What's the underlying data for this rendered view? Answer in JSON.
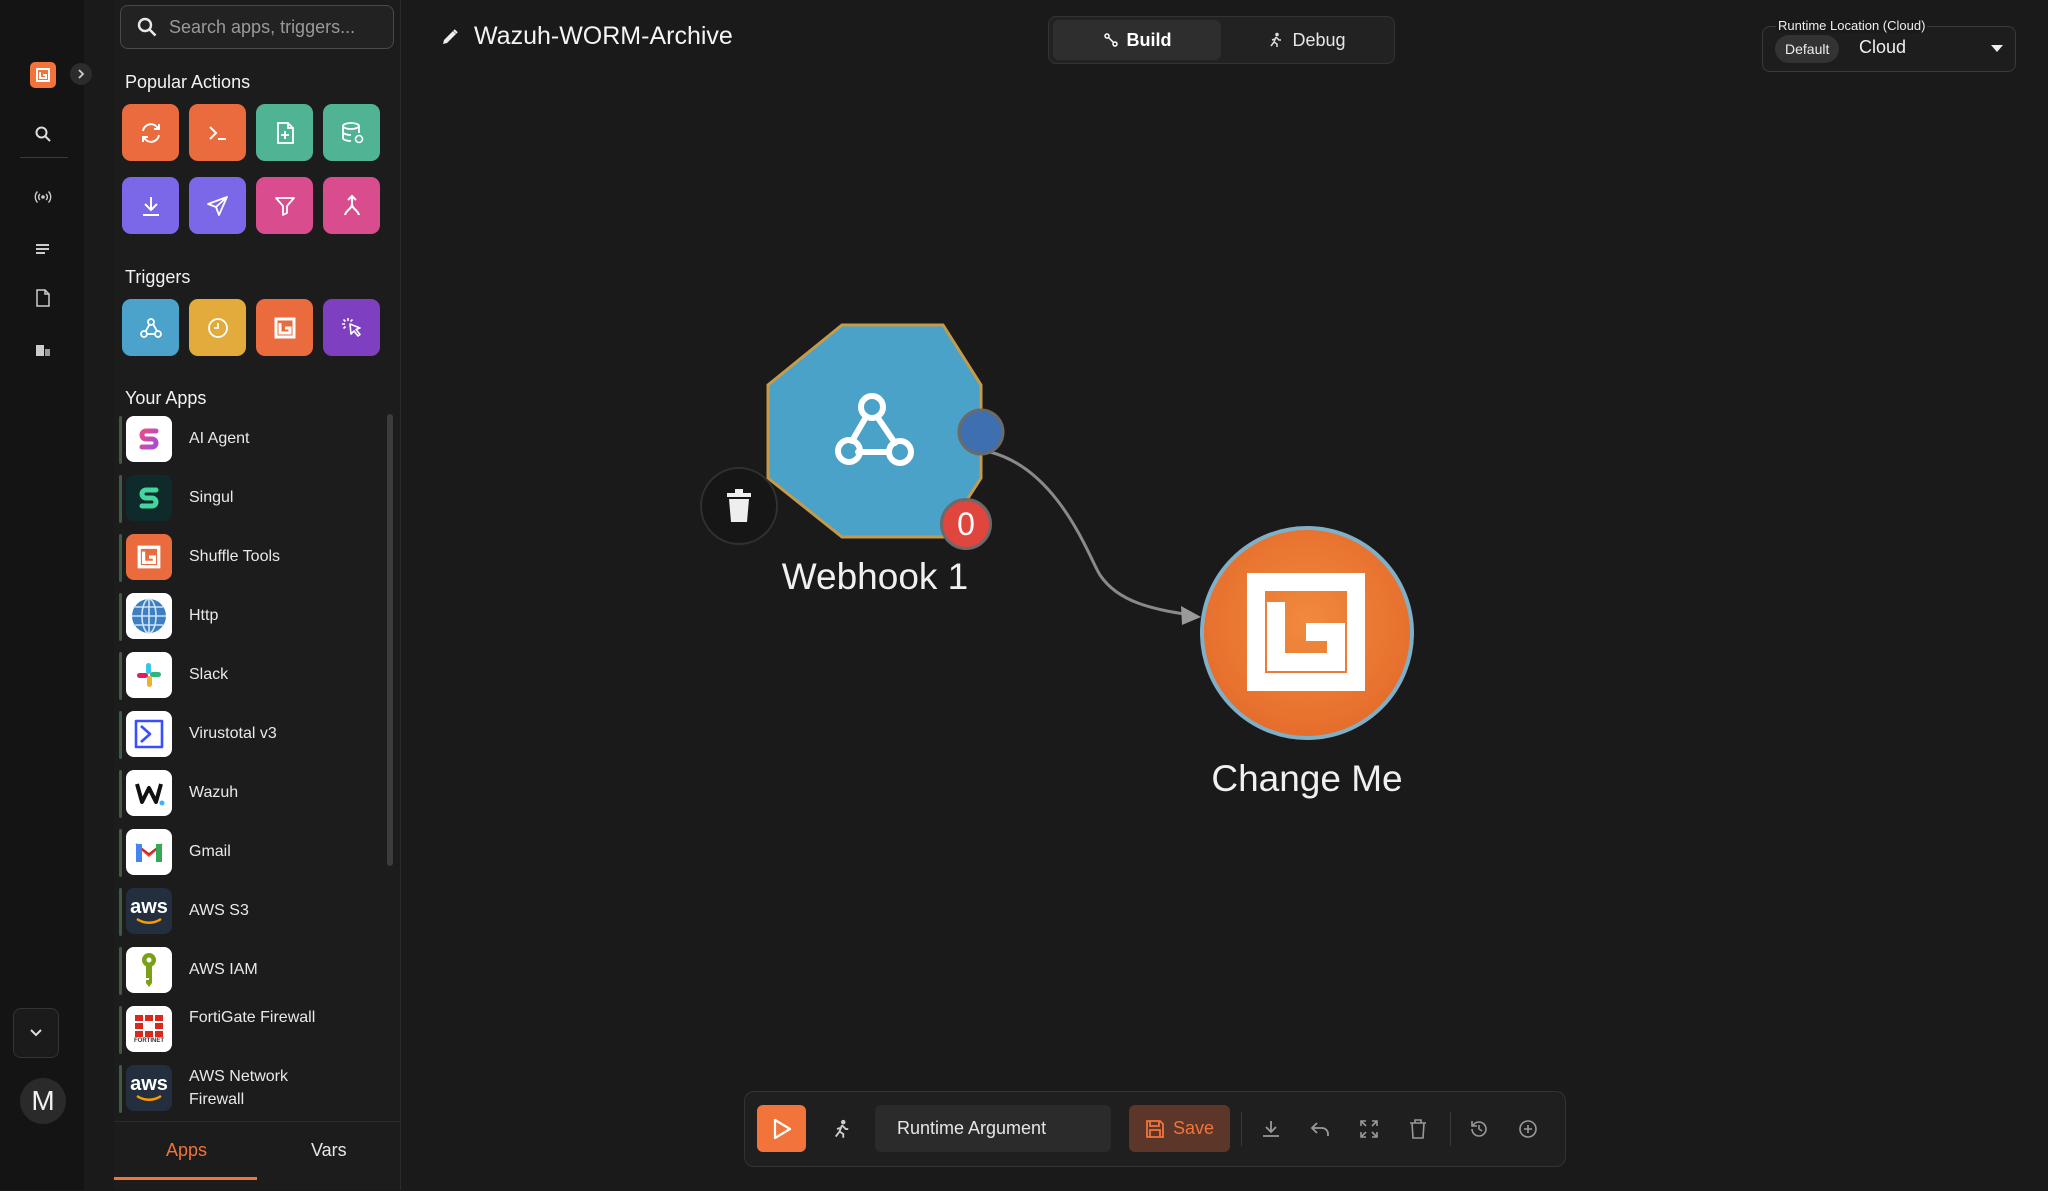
{
  "workflow": {
    "title": "Wazuh-WORM-Archive"
  },
  "search": {
    "placeholder": "Search apps, triggers..."
  },
  "sections": {
    "popular_actions": "Popular Actions",
    "triggers": "Triggers",
    "your_apps": "Your Apps"
  },
  "popular_actions": [
    {
      "icon": "repeat-icon",
      "color": "#ea6b3d"
    },
    {
      "icon": "terminal-icon",
      "color": "#ea6b3d"
    },
    {
      "icon": "file-add-icon",
      "color": "#4fb394"
    },
    {
      "icon": "database-icon",
      "color": "#4fb394"
    },
    {
      "icon": "download-icon",
      "color": "#7b68e8"
    },
    {
      "icon": "send-icon",
      "color": "#7b68e8"
    },
    {
      "icon": "filter-icon",
      "color": "#d94d8f"
    },
    {
      "icon": "merge-icon",
      "color": "#d94d8f"
    }
  ],
  "triggers": [
    {
      "icon": "webhook-icon",
      "color": "#4ba3cc"
    },
    {
      "icon": "clock-icon",
      "color": "#e3aa3c"
    },
    {
      "icon": "shuffle-logo-icon",
      "color": "#ea6b3d"
    },
    {
      "icon": "pointer-click-icon",
      "color": "#7e3fc0"
    }
  ],
  "apps": [
    {
      "label": "AI Agent",
      "icon": "ai-agent-icon"
    },
    {
      "label": "Singul",
      "icon": "singul-icon"
    },
    {
      "label": "Shuffle Tools",
      "icon": "shuffle-tools-icon"
    },
    {
      "label": "Http",
      "icon": "globe-icon"
    },
    {
      "label": "Slack",
      "icon": "slack-icon"
    },
    {
      "label": "Virustotal v3",
      "icon": "virustotal-icon"
    },
    {
      "label": "Wazuh",
      "icon": "wazuh-icon"
    },
    {
      "label": "Gmail",
      "icon": "gmail-icon"
    },
    {
      "label": "AWS S3",
      "icon": "aws-icon",
      "logo_text": "aws"
    },
    {
      "label": "AWS IAM",
      "icon": "aws-iam-icon"
    },
    {
      "label": "FortiGate Firewall",
      "icon": "fortinet-icon",
      "logo_text": "FORTINET"
    },
    {
      "label_line1": "AWS Network",
      "label_line2": "Firewall",
      "icon": "aws-icon",
      "logo_text": "aws"
    }
  ],
  "tabs": {
    "apps": "Apps",
    "vars": "Vars",
    "active": "Apps"
  },
  "mode": {
    "build": "Build",
    "debug": "Debug",
    "active": "Build"
  },
  "runtime": {
    "label": "Runtime Location (Cloud)",
    "chip": "Default",
    "value": "Cloud"
  },
  "rail": {
    "avatar": "M"
  },
  "nodes": {
    "webhook": {
      "label": "Webhook 1",
      "badge": "0",
      "color": "#4aa2c8",
      "border": "#c59a4a"
    },
    "change_me": {
      "label": "Change Me",
      "color": "#ea7433",
      "border": "#7fb0c8"
    }
  },
  "toolbar": {
    "runtime_argument": "Runtime Argument",
    "save": "Save"
  },
  "colors": {
    "accent": "#f2743a",
    "background": "#1a1a1a",
    "panel": "#1c1c1c"
  }
}
